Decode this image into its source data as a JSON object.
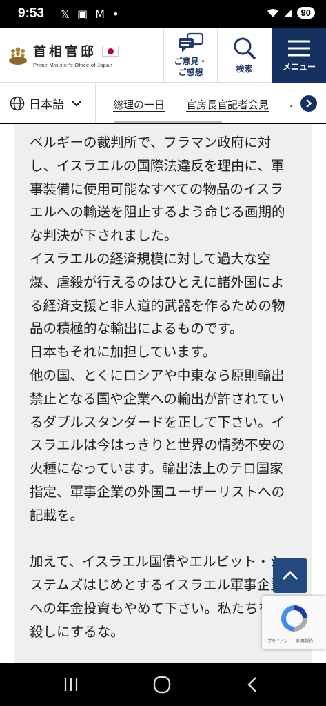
{
  "status_bar": {
    "time": "9:53",
    "left_icons": "𝕏 ▣ M •",
    "battery": "90"
  },
  "header": {
    "logo_title": "首相官邸",
    "logo_subtitle": "Prime Minister's Office of Japan",
    "opinion_label_1": "ご意見・",
    "opinion_label_2": "ご感想",
    "search_label": "検索",
    "menu_label": "メニュー"
  },
  "navbar": {
    "language": "日本語",
    "links": [
      "総理の一日",
      "官房長官記者会見"
    ],
    "more": "."
  },
  "comment": {
    "paragraphs": [
      "ベルギーの裁判所で、フラマン政府に対し、イスラエルの国際法違反を理由に、軍事装備に使用可能なすべての物品のイスラエルへの輸送を阻止するよう命じる画期的な判決が下されました。",
      "イスラエルの経済規模に対して過大な空爆、虐殺が行えるのはひとえに諸外国による経済支援と非人道的武器を作るための物品の積極的な輸出によるものです。",
      "日本もそれに加担しています。",
      "他の国、とくにロシアや中東なら原則輸出禁止となる国や企業への輸出が許されているダブルスタンダードを正して下さい。イスラエルは今はっきりと世界の情勢不安の火種になっています。輸出法上のテロ国家指定、軍事企業の外国ユーザーリストへの記載を。",
      "加えて、イスラエル国債やエルビット・システムズはじめとするイスラエル軍事企業への年金投資もやめて下さい。私たちを人殺しにするな。"
    ]
  },
  "recaptcha": {
    "footer": "プライバシー・利用規約"
  },
  "colors": {
    "navy": "#14315f",
    "scroll_button": "#24497f",
    "panel": "#efefef"
  }
}
